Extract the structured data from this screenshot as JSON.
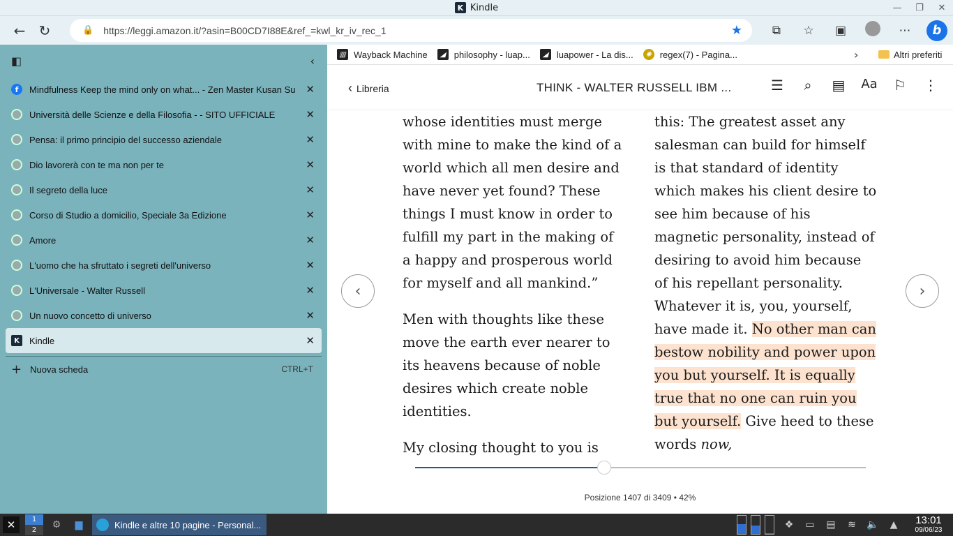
{
  "window": {
    "title": "Kindle"
  },
  "nav": {
    "url": "https://leggi.amazon.it/?asin=B00CD7I88E&ref_=kwl_kr_iv_rec_1"
  },
  "tabs": [
    {
      "label": "Mindfulness Keep the mind only on what... - Zen Master Kusan Su",
      "icon": "facebook-icon"
    },
    {
      "label": "Università delle Scienze e della Filosofia - - SITO UFFICIALE",
      "icon": "site-icon"
    },
    {
      "label": "Pensa: il primo principio del successo aziendale",
      "icon": "site-icon"
    },
    {
      "label": "Dio lavorerà con te ma non per te",
      "icon": "site-icon"
    },
    {
      "label": "Il segreto della luce",
      "icon": "site-icon"
    },
    {
      "label": "Corso di Studio a domicilio, Speciale 3a Edizione",
      "icon": "site-icon"
    },
    {
      "label": "Amore",
      "icon": "site-icon"
    },
    {
      "label": "L'uomo che ha sfruttato i segreti dell'universo",
      "icon": "site-icon"
    },
    {
      "label": "L'Universale - Walter Russell",
      "icon": "site-icon"
    },
    {
      "label": "Un nuovo concetto di universo",
      "icon": "site-icon"
    },
    {
      "label": "Kindle",
      "icon": "kindle-icon",
      "active": true
    }
  ],
  "new_tab": {
    "label": "Nuova scheda",
    "shortcut": "CTRL+T"
  },
  "favorites": [
    {
      "label": "Wayback Machine"
    },
    {
      "label": "philosophy - luap..."
    },
    {
      "label": "luapower - La dis..."
    },
    {
      "label": "regex(7) - Pagina..."
    }
  ],
  "favorites_other": "Altri preferiti",
  "kindle": {
    "back_label": "Libreria",
    "book_title": "THINK - WALTER RUSSELL IBM ...",
    "col1": {
      "p1": "whose identities must merge with mine to make the kind of a world which all men desire and have never yet found? These things I must know in order to fulfill my part in the making of a happy and prosperous world for myself and all mankind.”",
      "p2": "Men with thoughts like these move the earth ever nearer to its heavens because of noble desires which create noble identities.",
      "p3": "My closing thought to you is"
    },
    "col2": {
      "pre": "this: The greatest asset any salesman can build for himself is that standard of identity which makes his client desire to see him because of his magnetic personality, instead of desiring to avoid him because of his repellant personality. Whatever it is, you, yourself, have made it. ",
      "highlight": "No other man can bestow nobility and power upon you but yourself. It is equally true that no one can ruin you but yourself.",
      "post": " Give heed to these words ",
      "italic": "now,"
    },
    "position_text": "Posizione 1407 di 3409",
    "percent_text": "42%",
    "progress": 0.42
  },
  "taskbar": {
    "desk1": "1",
    "desk2": "2",
    "app_label": "Kindle e altre 10 pagine - Personal...",
    "time": "13:01",
    "date": "09/06/23"
  }
}
